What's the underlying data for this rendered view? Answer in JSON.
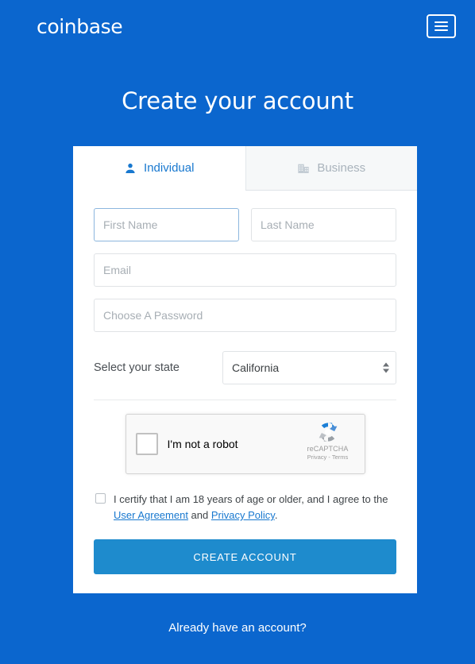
{
  "header": {
    "logo_text": "coinbase",
    "menu_icon": "hamburger-menu-icon"
  },
  "page_title": "Create your account",
  "tabs": [
    {
      "label": "Individual",
      "icon": "person-icon",
      "active": true
    },
    {
      "label": "Business",
      "icon": "building-icon",
      "active": false
    }
  ],
  "form": {
    "first_name": {
      "placeholder": "First Name",
      "value": "",
      "focused": true
    },
    "last_name": {
      "placeholder": "Last Name",
      "value": ""
    },
    "email": {
      "placeholder": "Email",
      "value": ""
    },
    "password": {
      "placeholder": "Choose A Password",
      "value": ""
    },
    "state": {
      "label": "Select your state",
      "selected": "California",
      "arrows_icon": "updown-arrows-icon"
    }
  },
  "recaptcha": {
    "label": "I'm not a robot",
    "brand": "reCAPTCHA",
    "terms": "Privacy - Terms",
    "logo_icon": "recaptcha-logo-icon",
    "checked": false
  },
  "certify": {
    "checked": false,
    "text_before": "I certify that I am 18 years of age or older, and I agree to the ",
    "link_user_agreement": "User Agreement",
    "text_middle": " and ",
    "link_privacy_policy": "Privacy Policy",
    "text_after": "."
  },
  "submit": {
    "label": "CREATE ACCOUNT"
  },
  "footer": {
    "link_label": "Already have an account?"
  },
  "colors": {
    "background": "#0b66ce",
    "accent_button": "#1e8bcd",
    "link": "#1878cf",
    "tab_inactive_bg": "#f6f8f9",
    "card_bg": "#ffffff"
  }
}
